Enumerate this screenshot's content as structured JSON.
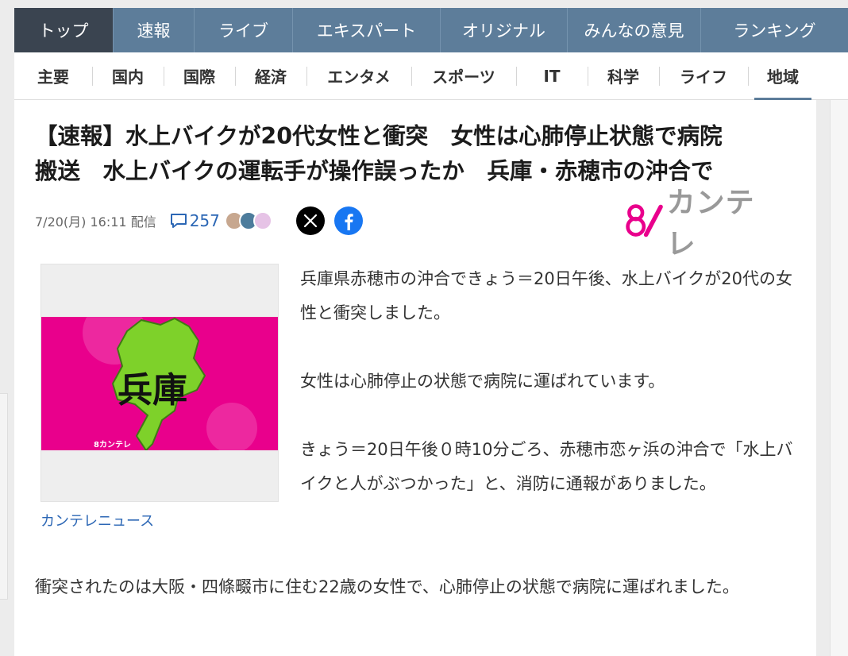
{
  "topnav": {
    "tabs": [
      {
        "label": "トップ",
        "active": true
      },
      {
        "label": "速報"
      },
      {
        "label": "ライブ"
      },
      {
        "label": "エキスパート"
      },
      {
        "label": "オリジナル"
      },
      {
        "label": "みんなの意見"
      },
      {
        "label": "ランキング"
      }
    ]
  },
  "subnav": {
    "items": [
      {
        "label": "主要"
      },
      {
        "label": "国内"
      },
      {
        "label": "国際"
      },
      {
        "label": "経済"
      },
      {
        "label": "エンタメ"
      },
      {
        "label": "スポーツ"
      },
      {
        "label": "IT"
      },
      {
        "label": "科学"
      },
      {
        "label": "ライフ"
      },
      {
        "label": "地域",
        "active": true
      }
    ]
  },
  "article": {
    "headline_line1": "【速報】水上バイクが20代女性と衝突　女性は心肺停止状態で病院",
    "headline_line2": "搬送　水上バイクの運転手が操作誤ったか　兵庫・赤穂市の沖合で",
    "date": "7/20(月) 16:11 配信",
    "comment_count": "257",
    "publisher_logo_mark": "8",
    "publisher_logo_text": "カンテレ",
    "image": {
      "prefecture_label": "兵庫",
      "watermark": "8カンテレ"
    },
    "image_caption": "カンテレニュース",
    "paragraphs": [
      "兵庫県赤穂市の沖合できょう＝20日午後、水上バイクが20代の女性と衝突しました。",
      "女性は心肺停止の状態で病院に運ばれています。",
      "きょう＝20日午後０時10分ごろ、赤穂市恋ヶ浜の沖合で「水上バイクと人がぶつかった」と、消防に通報がありました。"
    ],
    "paragraph_full": "衝突されたのは大阪・四條畷市に住む22歳の女性で、心肺停止の状態で病院に運ばれました。"
  },
  "colors": {
    "nav_bg": "#5d7d9a",
    "nav_active": "#3a4450",
    "link_blue": "#2c67b5",
    "brand_pink": "#e9008c"
  },
  "icons": {
    "comment": "comment-bubble-icon",
    "x": "x-logo-icon",
    "facebook": "facebook-logo-icon"
  }
}
